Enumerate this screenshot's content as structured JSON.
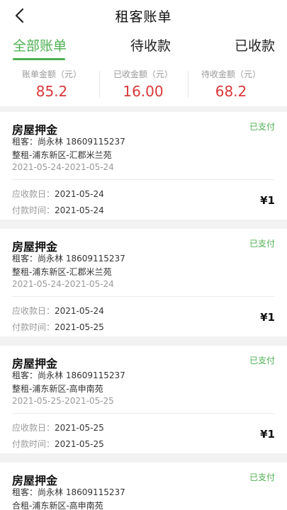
{
  "header": {
    "title": "租客账单"
  },
  "tabs": [
    {
      "label": "全部账单"
    },
    {
      "label": "待收款"
    },
    {
      "label": "已收款"
    }
  ],
  "summary": [
    {
      "label": "账单金额（元）",
      "value": "85.2"
    },
    {
      "label": "已收金额（元）",
      "value": "16.00"
    },
    {
      "label": "待收金额（元）",
      "value": "68.2"
    }
  ],
  "bills": [
    {
      "title": "房屋押金",
      "status": "已支付",
      "tenant": "租客：尚永林 18609115237",
      "property": "整租-浦东新区-汇郡米兰苑",
      "period": "2021-05-24-2021-05-24",
      "due_label": "应收款日：",
      "due": "2021-05-24",
      "paid_label": "付款时间：",
      "paid": "2021-05-24",
      "amount": "¥1"
    },
    {
      "title": "房屋押金",
      "status": "已支付",
      "tenant": "租客：尚永林 18609115237",
      "property": "整租-浦东新区-汇郡米兰苑",
      "period": "2021-05-24-2021-05-24",
      "due_label": "应收款日：",
      "due": "2021-05-24",
      "paid_label": "付款时间：",
      "paid": "2021-05-25",
      "amount": "¥1"
    },
    {
      "title": "房屋押金",
      "status": "已支付",
      "tenant": "租客：尚永林 18609115237",
      "property": "整租-浦东新区-高申南苑",
      "period": "2021-05-25-2021-05-25",
      "due_label": "应收款日：",
      "due": "2021-05-25",
      "paid_label": "付款时间：",
      "paid": "2021-05-25",
      "amount": "¥1"
    },
    {
      "title": "房屋押金",
      "status": "已支付",
      "tenant": "租客：尚永林 18609115237",
      "property": "合租-浦东新区-高申南苑",
      "period": "",
      "due_label": "",
      "due": "",
      "paid_label": "",
      "paid": "",
      "amount": ""
    }
  ],
  "colors": {
    "accent": "#4caf50",
    "amount_red": "#d9383a"
  },
  "icons": {
    "back": "chevron-left-icon"
  }
}
